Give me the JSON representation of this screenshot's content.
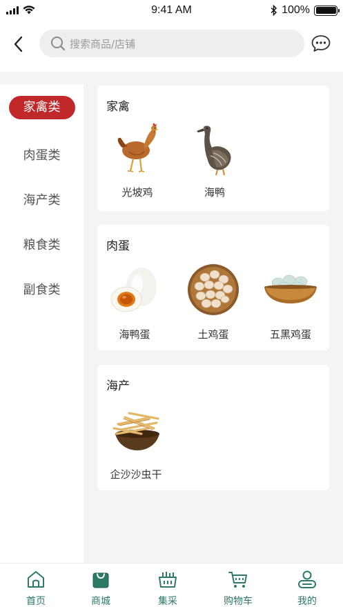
{
  "status_bar": {
    "time": "9:41 AM",
    "battery": "100%"
  },
  "search": {
    "placeholder": "搜索商品/店铺"
  },
  "sidebar": {
    "items": [
      {
        "label": "家禽类",
        "active": true
      },
      {
        "label": "肉蛋类",
        "active": false
      },
      {
        "label": "海产类",
        "active": false
      },
      {
        "label": "粮食类",
        "active": false
      },
      {
        "label": "副食类",
        "active": false
      }
    ]
  },
  "sections": [
    {
      "title": "家禽",
      "products": [
        {
          "name": "光坡鸡",
          "icon": "chicken-image"
        },
        {
          "name": "海鸭",
          "icon": "duck-image"
        }
      ]
    },
    {
      "title": "肉蛋",
      "products": [
        {
          "name": "海鸭蛋",
          "icon": "salted-duck-egg-image"
        },
        {
          "name": "土鸡蛋",
          "icon": "chicken-eggs-basket-image"
        },
        {
          "name": "五黑鸡蛋",
          "icon": "green-eggs-bowl-image"
        }
      ]
    },
    {
      "title": "海产",
      "products": [
        {
          "name": "企沙沙虫干",
          "icon": "dried-sandworm-image"
        }
      ]
    }
  ],
  "tabbar": {
    "items": [
      {
        "label": "首页",
        "icon": "home-icon"
      },
      {
        "label": "商城",
        "icon": "shopping-bag-icon"
      },
      {
        "label": "集采",
        "icon": "basket-icon"
      },
      {
        "label": "购物车",
        "icon": "cart-icon"
      },
      {
        "label": "我的",
        "icon": "user-icon"
      }
    ]
  },
  "colors": {
    "accent": "#c0282a",
    "tab_color": "#2c7a66",
    "background": "#f4f4f4"
  }
}
